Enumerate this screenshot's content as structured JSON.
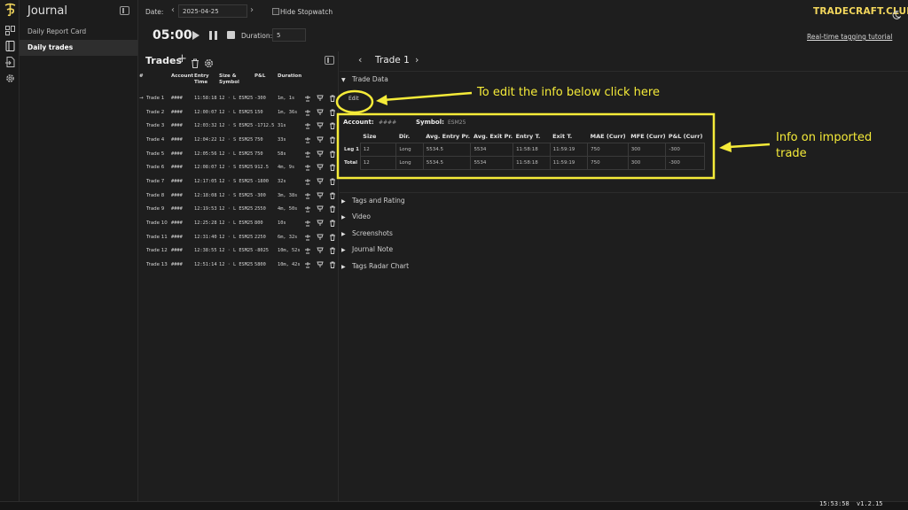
{
  "colors": {
    "accent_yellow": "#f5eb39",
    "brand_gold": "#f2d65c",
    "background": "#1e1e1e"
  },
  "rail": {
    "icons": [
      "logo-icon",
      "dashboard-icon",
      "journal-icon",
      "import-icon",
      "settings-icon"
    ]
  },
  "sidebar": {
    "title": "Journal",
    "items": [
      {
        "label": "Daily Report Card",
        "selected": false
      },
      {
        "label": "Daily trades",
        "selected": true
      }
    ]
  },
  "header": {
    "date_label": "Date:",
    "date_value": "2025-04-25",
    "hide_stopwatch_label": "Hide Stopwatch",
    "brand": "TRADECRAFT.CLUB"
  },
  "stopwatch": {
    "time": "05:00",
    "duration_label": "Duration:",
    "duration_value": "5",
    "tutorial_link": "Real-time tagging tutorial"
  },
  "trades": {
    "title": "Trades",
    "add_icon": "+",
    "columns": [
      "#",
      "Account",
      "Entry Time",
      "Size & Symbol",
      "P&L",
      "Duration"
    ],
    "rows": [
      {
        "name": "Trade 1",
        "account": "####",
        "entry": "11:58:18",
        "size_symbol": "12 · L ESM25",
        "pnl": "-300",
        "duration": "1m, 1s",
        "current": true
      },
      {
        "name": "Trade 2",
        "account": "####",
        "entry": "12:00:07",
        "size_symbol": "12 · L ESM25",
        "pnl": "150",
        "duration": "1m, 36s",
        "current": false
      },
      {
        "name": "Trade 3",
        "account": "####",
        "entry": "12:03:32",
        "size_symbol": "12 · S ESM25",
        "pnl": "-1712.5",
        "duration": "31s",
        "current": false
      },
      {
        "name": "Trade 4",
        "account": "####",
        "entry": "12:04:22",
        "size_symbol": "12 · S ESM25",
        "pnl": "750",
        "duration": "33s",
        "current": false
      },
      {
        "name": "Trade 5",
        "account": "####",
        "entry": "12:05:56",
        "size_symbol": "12 · L ESM25",
        "pnl": "750",
        "duration": "58s",
        "current": false
      },
      {
        "name": "Trade 6",
        "account": "####",
        "entry": "12:08:07",
        "size_symbol": "12 · S ESM25",
        "pnl": "912.5",
        "duration": "4m, 9s",
        "current": false
      },
      {
        "name": "Trade 7",
        "account": "####",
        "entry": "12:17:05",
        "size_symbol": "12 · S ESM25",
        "pnl": "-1800",
        "duration": "32s",
        "current": false
      },
      {
        "name": "Trade 8",
        "account": "####",
        "entry": "12:18:08",
        "size_symbol": "12 · S ESM25",
        "pnl": "-300",
        "duration": "3m, 38s",
        "current": false
      },
      {
        "name": "Trade 9",
        "account": "####",
        "entry": "12:19:53",
        "size_symbol": "12 · L ESM25",
        "pnl": "2550",
        "duration": "4m, 50s",
        "current": false
      },
      {
        "name": "Trade 10",
        "account": "####",
        "entry": "12:25:28",
        "size_symbol": "12 · L ESM25",
        "pnl": "800",
        "duration": "10s",
        "current": false
      },
      {
        "name": "Trade 11",
        "account": "####",
        "entry": "12:31:40",
        "size_symbol": "12 · L ESM25",
        "pnl": "2250",
        "duration": "6m, 32s",
        "current": false
      },
      {
        "name": "Trade 12",
        "account": "####",
        "entry": "12:38:55",
        "size_symbol": "12 · L ESM25",
        "pnl": "-8025",
        "duration": "10m, 52s",
        "current": false
      },
      {
        "name": "Trade 13",
        "account": "####",
        "entry": "12:51:14",
        "size_symbol": "12 · L ESM25",
        "pnl": "5800",
        "duration": "10m, 42s",
        "current": false
      }
    ]
  },
  "detail": {
    "title": "Trade 1",
    "sections": {
      "trade_data": "Trade Data",
      "tags": "Tags and Rating",
      "video": "Video",
      "screenshots": "Screenshots",
      "journal": "Journal Note",
      "radar": "Tags Radar Chart"
    },
    "edit_label": "Edit",
    "account_label": "Account:",
    "account_value": "####",
    "symbol_label": "Symbol:",
    "symbol_value": "ESM25",
    "table": {
      "columns": [
        "",
        "Size",
        "Dir.",
        "Avg. Entry Pr.",
        "Avg. Exit Pr.",
        "Entry T.",
        "Exit T.",
        "MAE (Curr)",
        "MFE (Curr)",
        "P&L (Curr)"
      ],
      "rows": [
        {
          "label": "Leg 1",
          "cells": [
            "12",
            "Long",
            "5534.5",
            "5534",
            "11:58:18",
            "11:59:19",
            "750",
            "300",
            "-300"
          ]
        },
        {
          "label": "Total",
          "cells": [
            "12",
            "Long",
            "5534.5",
            "5534",
            "11:58:18",
            "11:59:19",
            "750",
            "300",
            "-300"
          ]
        }
      ]
    }
  },
  "annotations": {
    "edit_note": "To edit the info below click here",
    "info_note_line1": "Info on imported",
    "info_note_line2": "trade"
  },
  "footer": {
    "time": "15:53:58",
    "version": "v1.2.15"
  }
}
